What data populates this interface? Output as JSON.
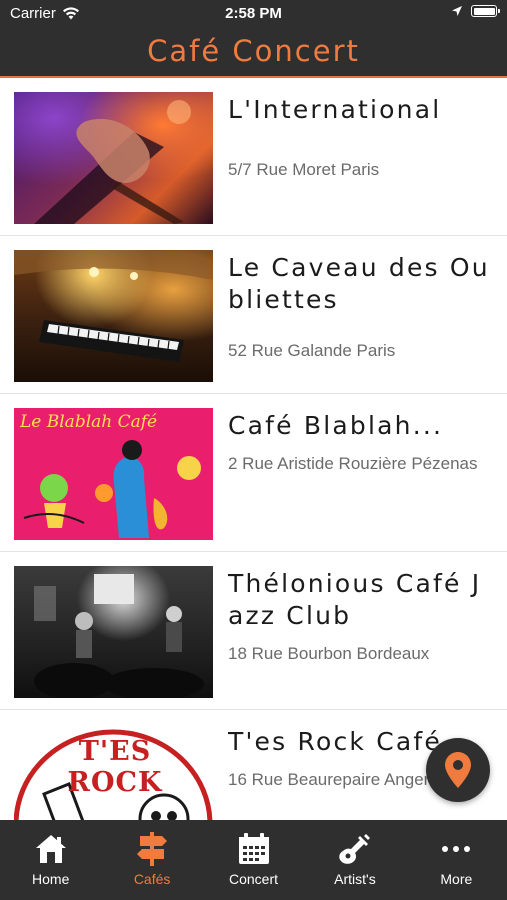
{
  "status_bar": {
    "carrier": "Carrier",
    "time": "2:58 PM"
  },
  "header": {
    "title": "Café Concert"
  },
  "colors": {
    "accent": "#f07b3f",
    "bar": "#2f2f2f"
  },
  "cafes": [
    {
      "name": "L'International",
      "address": "5/7 Rue Moret Paris",
      "image": "guitarist-photo"
    },
    {
      "name": "Le Caveau des Oubliettes",
      "address": "52 Rue Galande Paris",
      "image": "piano-cellar-photo"
    },
    {
      "name": "Café Blablah...",
      "address": "2 Rue Aristide Rouzière Pézenas",
      "image": "saxophonist-poster",
      "poster_text": "Le Blablah Café"
    },
    {
      "name": "Thélonious Café Jazz Club",
      "address": "18 Rue Bourbon Bordeaux",
      "image": "jazz-band-photo"
    },
    {
      "name": "T'es Rock Café",
      "address": "16 Rue Beaurepaire Angers",
      "image": "tes-rock-logo",
      "logo_text": "T'ES ROCK"
    }
  ],
  "tabs": [
    {
      "label": "Home",
      "icon": "home-icon",
      "active": false
    },
    {
      "label": "Cafés",
      "icon": "signpost-icon",
      "active": true
    },
    {
      "label": "Concert",
      "icon": "calendar-icon",
      "active": false
    },
    {
      "label": "Artist's",
      "icon": "guitar-icon",
      "active": false
    },
    {
      "label": "More",
      "icon": "more-icon",
      "active": false
    }
  ],
  "map_button": {
    "icon": "map-pin-icon"
  }
}
